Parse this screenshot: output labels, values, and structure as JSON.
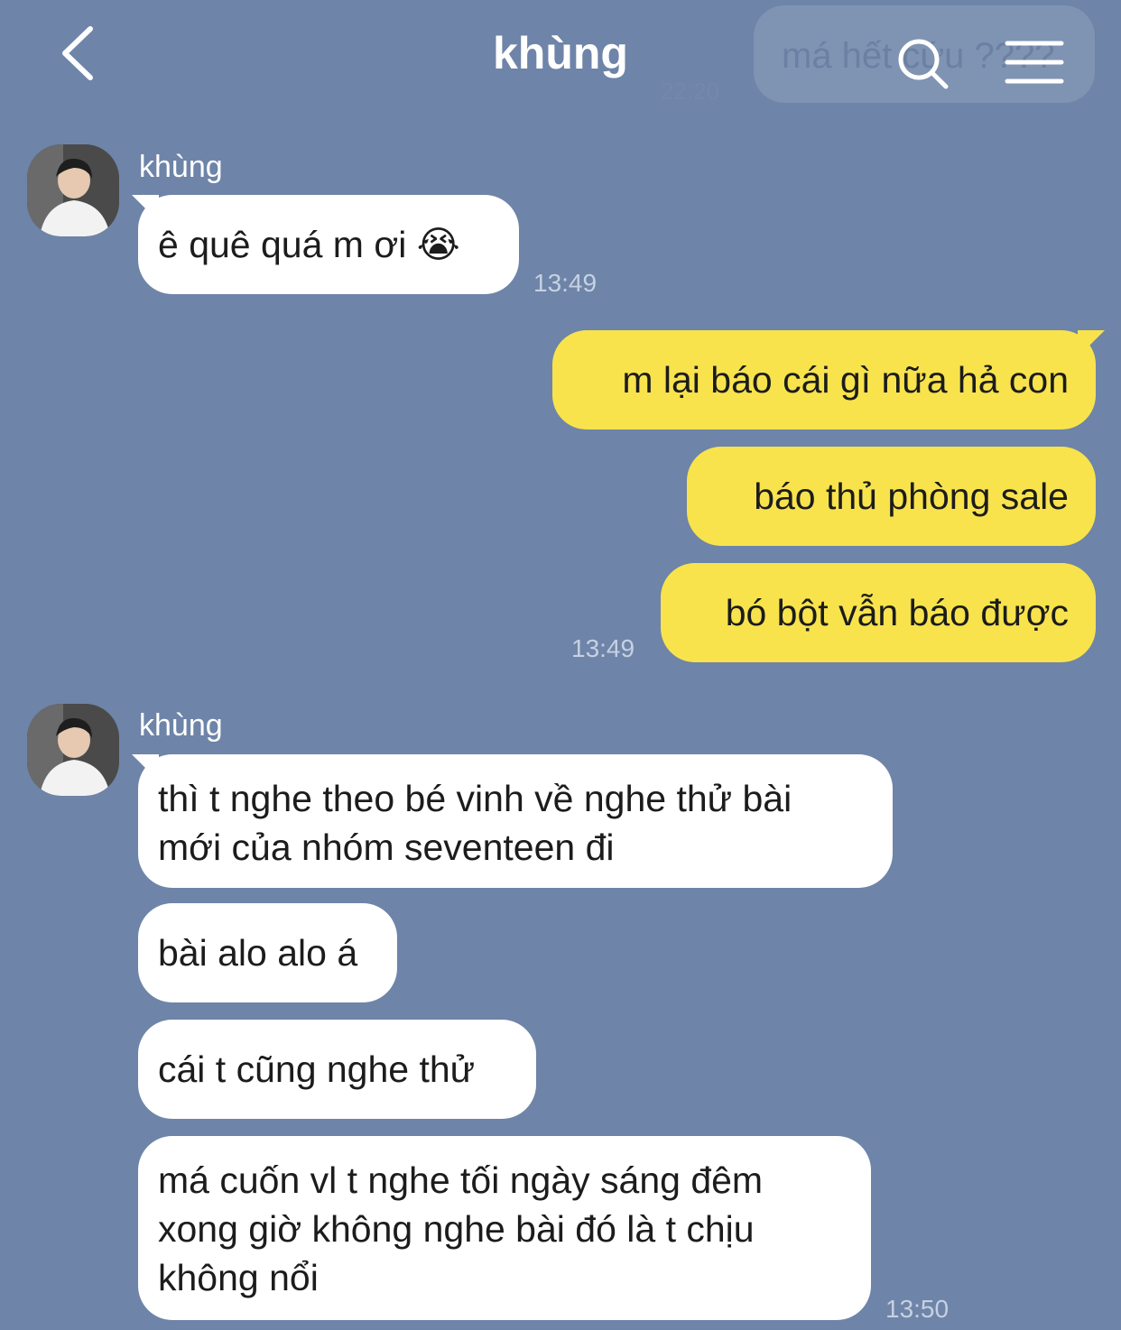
{
  "header": {
    "title": "khùng",
    "background_preview": {
      "text": "má hết cứu ????",
      "time": "22:20"
    },
    "icons": [
      "back-icon",
      "search-icon",
      "menu-icon"
    ]
  },
  "colors": {
    "background": "#6e84a8",
    "incoming_bubble": "#ffffff",
    "outgoing_bubble": "#f8e34d",
    "timestamp": "#c6d1e2"
  },
  "groups": [
    {
      "sender": "khùng",
      "messages": [
        {
          "text": "ê quê quá m ơi",
          "emoji": "😭"
        }
      ],
      "time": "13:49"
    },
    {
      "messages": [
        {
          "text": "m lại báo cái gì nữa hả con"
        },
        {
          "text": "báo thủ phòng sale"
        },
        {
          "text": "bó bột vẫn báo được"
        }
      ],
      "time": "13:49"
    },
    {
      "sender": "khùng",
      "messages": [
        {
          "line1": "thì t nghe theo bé vinh về nghe thử bài",
          "line2": "mới của nhóm seventeen đi"
        },
        {
          "text": "bài alo alo á"
        },
        {
          "text": "cái t cũng nghe thử"
        },
        {
          "line1": "má cuốn vl t nghe tối ngày sáng đêm",
          "line2": "xong giờ không nghe bài đó là t chịu",
          "line3": "không nổi"
        }
      ],
      "time": "13:50"
    }
  ]
}
